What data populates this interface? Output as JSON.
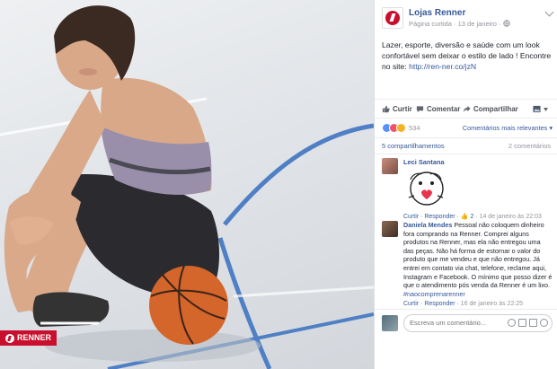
{
  "photo": {
    "brand_label": "RENNER"
  },
  "post": {
    "page_name": "Lojas Renner",
    "meta": "Página curtida · 13 de janeiro · ",
    "text": "Lazer, esporte, diversão e saúde com um look confortável sem deixar o estilo de lado ! Encontre no site: ",
    "link": "http://ren-ner.co/jzN"
  },
  "actions": {
    "like": "Curtir",
    "comment": "Comentar",
    "share": "Compartilhar"
  },
  "reactions": {
    "count": "534",
    "sort": "Comentários mais relevantes ▾",
    "shares": "5 compartilhamentos",
    "comments": "2 comentários"
  },
  "comments": [
    {
      "author": "Leci Santana",
      "text": "",
      "reply": "Curtir · Responder · ",
      "likes": "👍 2",
      "time": " · 14 de janeiro às 22:03"
    },
    {
      "author": "Daniela Mendes",
      "text": "Pessoal não coloquem dinheiro fora comprando na Renner. Comprei alguns produtos na Renner, mas ela não entregou uma das peças. Não há forma de estornar o valor do produto que me vendeu e que não entregou. Já entrei em contato via chat, telefone, reclame aqui, Instagram e Facebook. O mínimo que posso dizer é que o atendimento pós venda da Renner é um lixo. ",
      "hashtag": "#naocomprenarenner",
      "reply": "Curtir · Responder · ",
      "time": "16 de janeiro às 22:25"
    }
  ],
  "composer": {
    "placeholder": "Escreva um comentário..."
  },
  "colors": {
    "brand_red": "#c8102e",
    "fb_link": "#365899",
    "court_blue": "#3f71b8"
  }
}
